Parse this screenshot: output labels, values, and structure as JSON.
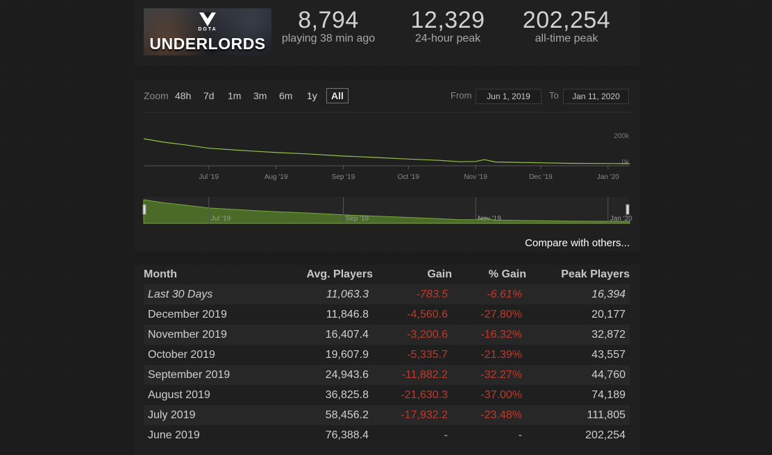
{
  "game": {
    "title": "UNDERLORDS",
    "subtitle": "DOTA"
  },
  "stats": [
    {
      "value": "8,794",
      "label": "playing 38 min ago"
    },
    {
      "value": "12,329",
      "label": "24-hour peak"
    },
    {
      "value": "202,254",
      "label": "all-time peak"
    }
  ],
  "zoom": {
    "label": "Zoom",
    "options": [
      "48h",
      "7d",
      "1m",
      "3m",
      "6m",
      "1y",
      "All"
    ],
    "selected": "All"
  },
  "range": {
    "from_label": "From",
    "from_value": "Jun 1, 2019",
    "to_label": "To",
    "to_value": "Jan 11, 2020"
  },
  "compare_link": "Compare with others...",
  "colors": {
    "line": "#94c345",
    "fill": "#4a6a28",
    "negative": "#c0392b"
  },
  "chart_data": {
    "type": "line",
    "y_tick_labels": [
      "200k",
      "0k"
    ],
    "x_tick_labels": [
      "Jul '19",
      "Aug '19",
      "Sep '19",
      "Oct '19",
      "Nov '19",
      "Dec '19",
      "Jan '20"
    ],
    "navigator_labels": [
      "Jul '19",
      "Sep '19",
      "Nov '19",
      "Jan '20"
    ],
    "ylim": [
      0,
      200000
    ],
    "series": [
      {
        "x": [
          "2019-06-01",
          "2019-06-10",
          "2019-06-20",
          "2019-07-01",
          "2019-07-15",
          "2019-08-01",
          "2019-08-15",
          "2019-09-01",
          "2019-09-15",
          "2019-10-01",
          "2019-10-15",
          "2019-10-25",
          "2019-11-01",
          "2019-11-05",
          "2019-11-10",
          "2019-11-20",
          "2019-12-01",
          "2019-12-15",
          "2020-01-01",
          "2020-01-11"
        ],
        "y": [
          200000,
          175000,
          155000,
          130000,
          115000,
          98000,
          88000,
          72000,
          62000,
          50000,
          40000,
          30000,
          32000,
          45000,
          28000,
          25000,
          22000,
          18000,
          17000,
          16000
        ]
      }
    ]
  },
  "table": {
    "headers": [
      "Month",
      "Avg. Players",
      "Gain",
      "% Gain",
      "Peak Players"
    ],
    "rows": [
      {
        "month": "Last 30 Days",
        "avg": "11,063.3",
        "gain": "-783.5",
        "pct": "-6.61%",
        "peak": "16,394"
      },
      {
        "month": "December 2019",
        "avg": "11,846.8",
        "gain": "-4,560.6",
        "pct": "-27.80%",
        "peak": "20,177"
      },
      {
        "month": "November 2019",
        "avg": "16,407.4",
        "gain": "-3,200.6",
        "pct": "-16.32%",
        "peak": "32,872"
      },
      {
        "month": "October 2019",
        "avg": "19,607.9",
        "gain": "-5,335.7",
        "pct": "-21.39%",
        "peak": "43,557"
      },
      {
        "month": "September 2019",
        "avg": "24,943.6",
        "gain": "-11,882.2",
        "pct": "-32.27%",
        "peak": "44,760"
      },
      {
        "month": "August 2019",
        "avg": "36,825.8",
        "gain": "-21,630.3",
        "pct": "-37.00%",
        "peak": "74,189"
      },
      {
        "month": "July 2019",
        "avg": "58,456.2",
        "gain": "-17,932.2",
        "pct": "-23.48%",
        "peak": "111,805"
      },
      {
        "month": "June 2019",
        "avg": "76,388.4",
        "gain": "-",
        "pct": "-",
        "peak": "202,254"
      }
    ]
  }
}
